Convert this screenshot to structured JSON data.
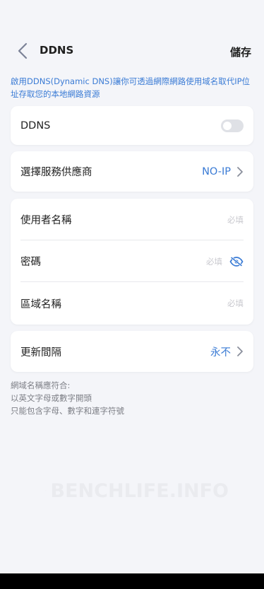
{
  "header": {
    "title": "DDNS",
    "save_label": "儲存"
  },
  "description": "啟用DDNS(Dynamic DNS)讓你可透過網際網路使用域名取代IP位址存取您的本地網路資源",
  "ddns_toggle": {
    "label": "DDNS",
    "enabled": false
  },
  "provider": {
    "label": "選擇服務供應商",
    "value": "NO-IP"
  },
  "credentials": {
    "username": {
      "label": "使用者名稱",
      "placeholder": "必填"
    },
    "password": {
      "label": "密碼",
      "placeholder": "必填"
    },
    "domain": {
      "label": "區域名稱",
      "placeholder": "必填"
    }
  },
  "interval": {
    "label": "更新間隔",
    "value": "永不"
  },
  "hint": {
    "line1": "網域名稱應符合:",
    "line2": "以英文字母或數字開頭",
    "line3": "只能包含字母、數字和連字符號"
  },
  "watermark": "BENCHLIFE.INFO",
  "colors": {
    "accent": "#3a7bd5",
    "background": "#f4f5f9",
    "card": "#ffffff"
  }
}
